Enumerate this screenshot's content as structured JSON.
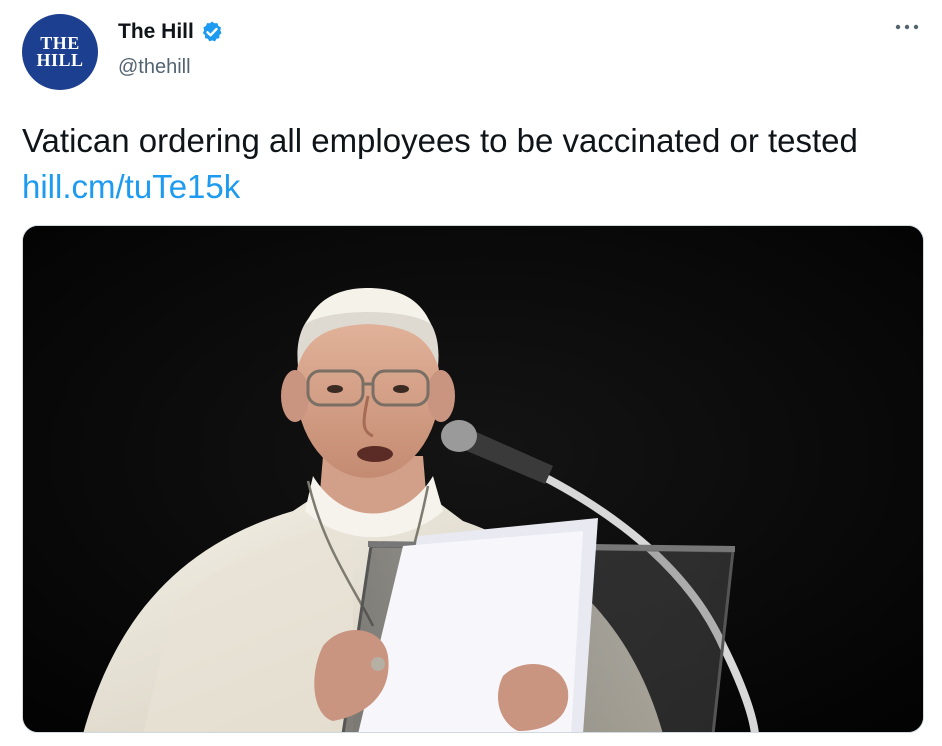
{
  "author": {
    "avatar_line1": "THE",
    "avatar_line2": "HILL",
    "name": "The Hill",
    "handle": "@thehill",
    "verified_icon": "verified-badge-icon",
    "brand_color": "#1d3f8f"
  },
  "tweet": {
    "text": "Vatican ordering all employees to be vaccinated or tested ",
    "link_text": "hill.cm/tuTe15k",
    "link_color": "#1d9bf0"
  },
  "menu": {
    "icon": "more-options-icon"
  },
  "media": {
    "icon": "photo-image"
  }
}
